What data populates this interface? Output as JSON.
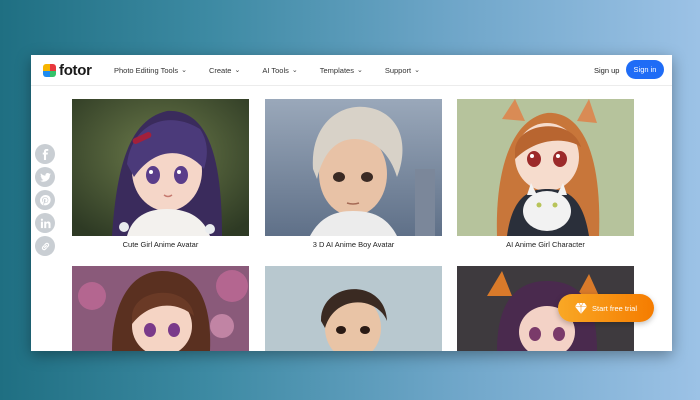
{
  "brand": {
    "name": "fotor"
  },
  "nav": {
    "items": [
      {
        "label": "Photo Editing Tools"
      },
      {
        "label": "Create"
      },
      {
        "label": "AI Tools"
      },
      {
        "label": "Templates"
      },
      {
        "label": "Support"
      }
    ]
  },
  "auth": {
    "signup_label": "Sign up",
    "signin_label": "Sign in"
  },
  "share": {
    "icons": [
      "facebook-icon",
      "twitter-icon",
      "pinterest-icon",
      "linkedin-icon",
      "link-icon"
    ]
  },
  "gallery": {
    "cards": [
      {
        "caption": "Cute Girl Anime Avatar"
      },
      {
        "caption": "3 D AI Anime Boy Avatar"
      },
      {
        "caption": "AI Anime Girl Character"
      }
    ]
  },
  "cta": {
    "label": "Start free trial"
  },
  "colors": {
    "accent": "#1f6cf6",
    "cta": "#f57c00"
  }
}
